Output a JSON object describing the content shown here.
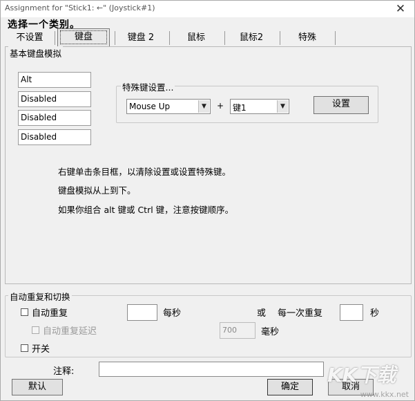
{
  "window": {
    "title": "Assignment for \"Stick1: ←\" (Joystick#1)",
    "close_glyph": "✕"
  },
  "heading": "选择一个类别。",
  "tabs": [
    {
      "label": "不设置",
      "active": false
    },
    {
      "label": "键盘",
      "active": true
    },
    {
      "label": "键盘 2",
      "active": false
    },
    {
      "label": "鼠标",
      "active": false
    },
    {
      "label": "鼠标2",
      "active": false
    },
    {
      "label": "特殊",
      "active": false
    }
  ],
  "keyboard_emulation": {
    "group_label": "基本键盘模拟",
    "keys": [
      "Alt",
      "Disabled",
      "Disabled",
      "Disabled"
    ],
    "special_key": {
      "group_label": "特殊键设置...",
      "type_value": "Mouse Up",
      "plus": "+",
      "key_value": "键1",
      "set_button": "设置",
      "dropdown_icon": "chevron-down-icon"
    },
    "instructions": [
      "右键单击条目框，以清除设置或设置特殊键。",
      "键盘模拟从上到下。",
      "如果你组合 alt 键或 Ctrl 键，注意按键顺序。"
    ]
  },
  "auto_repeat": {
    "group_label": "自动重复和切换",
    "auto_repeat_label": "自动重复",
    "auto_repeat_checked": false,
    "per_second_value": "",
    "per_second_label": "每秒",
    "or_label": "或",
    "every_repeat_label": "每一次重复",
    "seconds_value": "",
    "seconds_label": "秒",
    "delay_label": "自动重复延迟",
    "delay_checked": false,
    "delay_enabled": false,
    "delay_value": "700",
    "ms_label": "毫秒",
    "toggle_label": "开关",
    "toggle_checked": false
  },
  "note": {
    "label": "注释:",
    "value": ""
  },
  "buttons": {
    "default": "默认",
    "ok": "确定",
    "cancel": "取消"
  },
  "watermark": {
    "text": "KK下载",
    "url": "www.kkx.net"
  }
}
